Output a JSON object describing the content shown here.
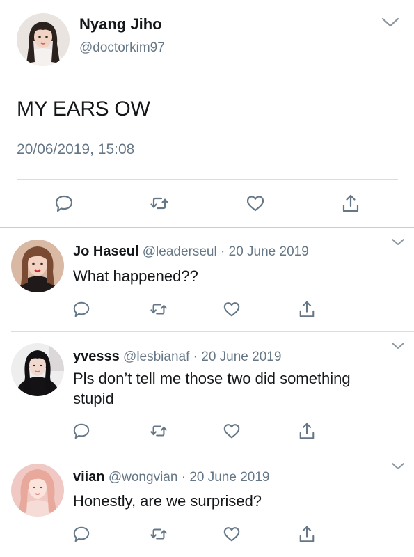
{
  "tweet": {
    "author_name": "Nyang Jiho",
    "author_handle": "@doctorkim97",
    "text": "MY EARS OW",
    "timestamp": "20/06/2019, 15:08",
    "icons": [
      "reply-icon",
      "retweet-icon",
      "like-icon",
      "share-icon",
      "chevron-down-icon"
    ]
  },
  "replies": [
    {
      "name": "Jo Haseul",
      "handle": "@leaderseul",
      "date": "20 June 2019",
      "text": "What happened??"
    },
    {
      "name": "yvesss",
      "handle": "@lesbianaf",
      "date": "20 June 2019",
      "text": "Pls don’t tell me those two did something stupid"
    },
    {
      "name": "viian",
      "handle": "@wongvian",
      "date": "20 June 2019",
      "text": "Honestly, are we surprised?"
    }
  ],
  "separator_char": " · ",
  "colors": {
    "primary_text": "#14171a",
    "secondary_text": "#657786",
    "icon": "#657786",
    "divider": "#d9dde1"
  }
}
